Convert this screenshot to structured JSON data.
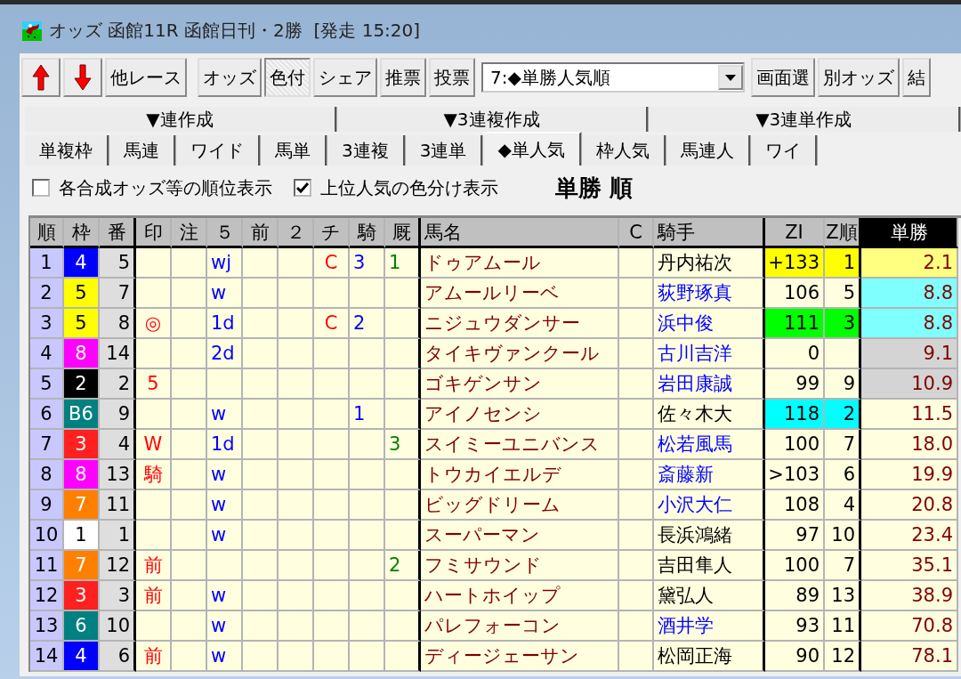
{
  "window": {
    "title": "オッズ 函館11R 函館日刊・2勝  [発走 15:20]"
  },
  "toolbar": {
    "buttons": [
      {
        "kind": "up"
      },
      {
        "kind": "down"
      },
      {
        "kind": "text",
        "label": "他レース"
      }
    ],
    "view_buttons": [
      {
        "label": "オッズ",
        "selected": false
      },
      {
        "label": "色付",
        "selected": true
      },
      {
        "label": "シェア",
        "selected": false
      },
      {
        "label": "推票",
        "selected": false
      },
      {
        "label": "投票",
        "selected": false
      }
    ],
    "dropdown": {
      "value": "7:◆単勝人気順"
    },
    "right_buttons": [
      "画面選",
      "別オッズ",
      "結"
    ]
  },
  "group_headers": [
    "▼連作成",
    "▼3連複作成",
    "▼3連単作成"
  ],
  "tabs": [
    {
      "label": "単複枠",
      "selected": false
    },
    {
      "label": "馬連",
      "selected": false
    },
    {
      "label": "ワイド",
      "selected": false
    },
    {
      "label": "馬単",
      "selected": false
    },
    {
      "label": "3連複",
      "selected": false
    },
    {
      "label": "3連単",
      "selected": false
    },
    {
      "label": "◆単人気",
      "selected": true
    },
    {
      "label": "枠人気",
      "selected": false
    },
    {
      "label": "馬連人",
      "selected": false
    },
    {
      "label": "ワイ",
      "selected": false
    }
  ],
  "options": [
    {
      "label": "各合成オッズ等の順位表示",
      "checked": false
    },
    {
      "label": "上位人気の色分け表示",
      "checked": true
    }
  ],
  "heading": "単勝 順",
  "table": {
    "columns": [
      "順",
      "枠",
      "番",
      "印",
      "注",
      "５",
      "前",
      "２",
      "チ",
      "騎",
      "厩",
      "馬名",
      "C",
      "騎手",
      "ZI",
      "Z順",
      "単勝"
    ],
    "rows": [
      {
        "rank": "1",
        "frame": {
          "text": "4",
          "color": "#0000ff"
        },
        "number": "5",
        "col_5": "wj",
        "col_chi": "C",
        "col_ki": "3",
        "col_kyu": "1",
        "name": "ドゥアムール",
        "jockey": {
          "text": "丹内祐次",
          "color": "#000000"
        },
        "zi": {
          "text": "+133",
          "color": "#ffff00"
        },
        "z_rank": {
          "text": "1",
          "color": "#ffff00"
        },
        "win_odds": {
          "text": "2.1",
          "color": "#ffff80"
        }
      },
      {
        "rank": "2",
        "frame": {
          "text": "5",
          "color": "#ffff00"
        },
        "number": "7",
        "col_5": "w",
        "name": "アムールリーベ",
        "jockey": {
          "text": "荻野琢真",
          "color": "#0000ff"
        },
        "zi": {
          "text": "106"
        },
        "z_rank": {
          "text": "5"
        },
        "win_odds": {
          "text": "8.8",
          "color": "#80ffff"
        }
      },
      {
        "rank": "3",
        "frame": {
          "text": "5",
          "color": "#ffff00"
        },
        "number": "8",
        "mark": "◎",
        "col_5": "1d",
        "col_chi": "C",
        "col_ki": "2",
        "name": "ニジュウダンサー",
        "jockey": {
          "text": "浜中俊",
          "color": "#0000ff"
        },
        "zi": {
          "text": "111",
          "color": "#00ff00"
        },
        "z_rank": {
          "text": "3",
          "color": "#00ff00"
        },
        "win_odds": {
          "text": "8.8",
          "color": "#80ffff"
        }
      },
      {
        "rank": "4",
        "frame": {
          "text": "8",
          "color": "#ff00ff"
        },
        "number": "14",
        "col_5": "2d",
        "name": "タイキヴァンクール",
        "jockey": {
          "text": "古川吉洋",
          "color": "#0000ff"
        },
        "zi": {
          "text": "0"
        },
        "win_odds": {
          "text": "9.1",
          "color": "#d4d4d4"
        }
      },
      {
        "rank": "5",
        "frame": {
          "text": "2",
          "color": "#000000"
        },
        "number": "2",
        "mark": "5",
        "name": "ゴキゲンサン",
        "jockey": {
          "text": "岩田康誠",
          "color": "#0000ff"
        },
        "zi": {
          "text": "99"
        },
        "z_rank": {
          "text": "9"
        },
        "win_odds": {
          "text": "10.9",
          "color": "#d4d4d4"
        }
      },
      {
        "rank": "6",
        "frame": {
          "text": "B6",
          "color": "#008080"
        },
        "number": "9",
        "col_5": "w",
        "col_ki": "1",
        "name": "アイノセンシ",
        "jockey": {
          "text": "佐々木大",
          "color": "#000000"
        },
        "zi": {
          "text": "118",
          "color": "#00ffff"
        },
        "z_rank": {
          "text": "2",
          "color": "#00ffff"
        },
        "win_odds": {
          "text": "11.5"
        }
      },
      {
        "rank": "7",
        "frame": {
          "text": "3",
          "color": "#ff2020"
        },
        "number": "4",
        "mark": "W",
        "col_5": "1d",
        "col_kyu": "3",
        "name": "スイミーユニバンス",
        "jockey": {
          "text": "松若風馬",
          "color": "#0000ff"
        },
        "zi": {
          "text": "100"
        },
        "z_rank": {
          "text": "7"
        },
        "win_odds": {
          "text": "18.0"
        }
      },
      {
        "rank": "8",
        "frame": {
          "text": "8",
          "color": "#ff00ff"
        },
        "number": "13",
        "mark": "騎",
        "col_5": "w",
        "name": "トウカイエルデ",
        "jockey": {
          "text": "斎藤新",
          "color": "#0000ff"
        },
        "zi": {
          "text": ">103"
        },
        "z_rank": {
          "text": "6"
        },
        "win_odds": {
          "text": "19.9"
        }
      },
      {
        "rank": "9",
        "frame": {
          "text": "7",
          "color": "#ff8000"
        },
        "number": "11",
        "col_5": "w",
        "name": "ビッグドリーム",
        "jockey": {
          "text": "小沢大仁",
          "color": "#0000ff"
        },
        "zi": {
          "text": "108"
        },
        "z_rank": {
          "text": "4"
        },
        "win_odds": {
          "text": "20.8"
        }
      },
      {
        "rank": "10",
        "frame": {
          "text": "1",
          "color": "#ffffff"
        },
        "number": "1",
        "col_5": "w",
        "name": "スーパーマン",
        "jockey": {
          "text": "長浜鴻緒",
          "color": "#000000"
        },
        "zi": {
          "text": "97"
        },
        "z_rank": {
          "text": "10"
        },
        "win_odds": {
          "text": "23.4"
        }
      },
      {
        "rank": "11",
        "frame": {
          "text": "7",
          "color": "#ff8000"
        },
        "number": "12",
        "mark": "前",
        "col_kyu": "2",
        "name": "フミサウンド",
        "jockey": {
          "text": "吉田隼人",
          "color": "#000000"
        },
        "zi": {
          "text": "100"
        },
        "z_rank": {
          "text": "7"
        },
        "win_odds": {
          "text": "35.1"
        }
      },
      {
        "rank": "12",
        "frame": {
          "text": "3",
          "color": "#ff2020"
        },
        "number": "3",
        "mark": "前",
        "col_5": "w",
        "name": "ハートホイップ",
        "jockey": {
          "text": "黛弘人",
          "color": "#000000"
        },
        "zi": {
          "text": "89"
        },
        "z_rank": {
          "text": "13"
        },
        "win_odds": {
          "text": "38.9"
        }
      },
      {
        "rank": "13",
        "frame": {
          "text": "6",
          "color": "#008080"
        },
        "number": "10",
        "col_5": "w",
        "name": "パレフォーコン",
        "jockey": {
          "text": "酒井学",
          "color": "#0000ff"
        },
        "zi": {
          "text": "93"
        },
        "z_rank": {
          "text": "11"
        },
        "win_odds": {
          "text": "70.8"
        }
      },
      {
        "rank": "14",
        "frame": {
          "text": "4",
          "color": "#0000ff"
        },
        "number": "6",
        "mark": "前",
        "col_5": "w",
        "name": "ディージェーサン",
        "jockey": {
          "text": "松岡正海",
          "color": "#000000"
        },
        "zi": {
          "text": "90"
        },
        "z_rank": {
          "text": "12"
        },
        "win_odds": {
          "text": "78.1"
        }
      }
    ]
  }
}
